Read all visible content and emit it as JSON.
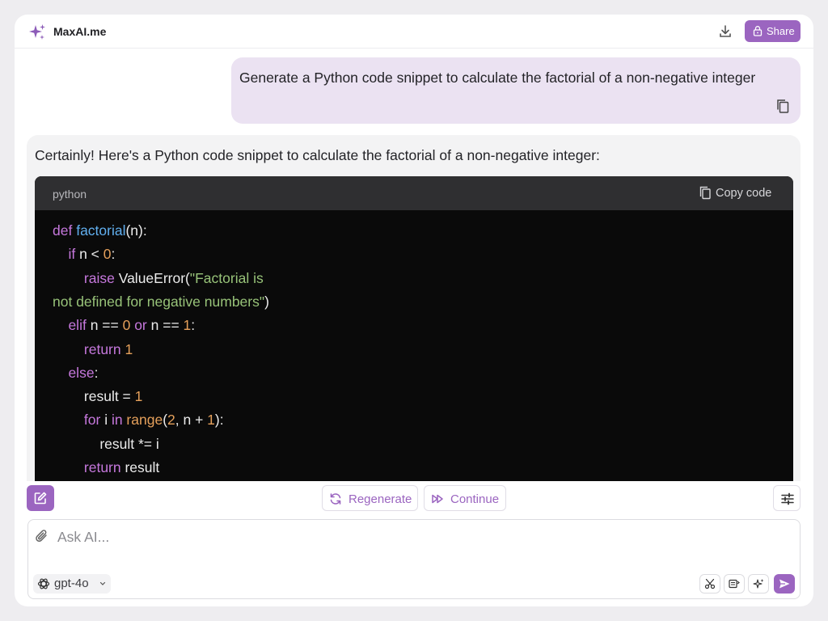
{
  "header": {
    "app_title": "MaxAI.me",
    "share_label": "Share"
  },
  "chat": {
    "user_message": "Generate a Python code snippet to calculate the factorial of a non-negative integer",
    "assistant_intro": "Certainly! Here's a Python code snippet to calculate the factorial of a non-negative integer:",
    "code_block": {
      "language": "python",
      "copy_label": "Copy code",
      "lines": [
        [
          {
            "t": "def ",
            "c": "kw"
          },
          {
            "t": "factorial",
            "c": "fn"
          },
          {
            "t": "(n):",
            "c": "plain"
          }
        ],
        [
          {
            "t": "    if ",
            "c": "kw"
          },
          {
            "t": "n < ",
            "c": "plain"
          },
          {
            "t": "0",
            "c": "num"
          },
          {
            "t": ":",
            "c": "plain"
          }
        ],
        [
          {
            "t": "        raise ",
            "c": "kw"
          },
          {
            "t": "ValueError(",
            "c": "plain"
          },
          {
            "t": "\"Factorial is",
            "c": "str"
          }
        ],
        [
          {
            "t": "not defined for negative numbers\"",
            "c": "str"
          },
          {
            "t": ")",
            "c": "plain"
          }
        ],
        [
          {
            "t": "    elif ",
            "c": "kw"
          },
          {
            "t": "n == ",
            "c": "plain"
          },
          {
            "t": "0 ",
            "c": "num"
          },
          {
            "t": "or ",
            "c": "kw"
          },
          {
            "t": "n == ",
            "c": "plain"
          },
          {
            "t": "1",
            "c": "num"
          },
          {
            "t": ":",
            "c": "plain"
          }
        ],
        [
          {
            "t": "        return ",
            "c": "kw"
          },
          {
            "t": "1",
            "c": "num"
          }
        ],
        [
          {
            "t": "    else",
            "c": "kw"
          },
          {
            "t": ":",
            "c": "plain"
          }
        ],
        [
          {
            "t": "        result = ",
            "c": "plain"
          },
          {
            "t": "1",
            "c": "num"
          }
        ],
        [
          {
            "t": "        for ",
            "c": "kw"
          },
          {
            "t": "i ",
            "c": "plain"
          },
          {
            "t": "in ",
            "c": "kw"
          },
          {
            "t": "range",
            "c": "num"
          },
          {
            "t": "(",
            "c": "plain"
          },
          {
            "t": "2",
            "c": "num"
          },
          {
            "t": ", n + ",
            "c": "plain"
          },
          {
            "t": "1",
            "c": "num"
          },
          {
            "t": "):",
            "c": "plain"
          }
        ],
        [
          {
            "t": "            result *= i",
            "c": "plain"
          }
        ],
        [
          {
            "t": "        return ",
            "c": "kw"
          },
          {
            "t": "result",
            "c": "plain"
          }
        ]
      ]
    }
  },
  "toolbar": {
    "regenerate_label": "Regenerate",
    "continue_label": "Continue"
  },
  "input": {
    "placeholder": "Ask AI...",
    "model_label": "gpt-4o"
  },
  "colors": {
    "accent": "#9b65c0",
    "user_bubble": "#ebe2f2",
    "assistant_bubble": "#f3f3f4",
    "code_background": "#0a0a0a"
  },
  "icons": [
    "sparkles-icon",
    "download-icon",
    "lock-icon",
    "copy-icon",
    "edit-icon",
    "refresh-icon",
    "fast-forward-icon",
    "sliders-icon",
    "paperclip-icon",
    "openai-icon",
    "chevron-down-icon",
    "scissors-icon",
    "screen-reader-icon",
    "sparkle-icon",
    "send-icon"
  ]
}
